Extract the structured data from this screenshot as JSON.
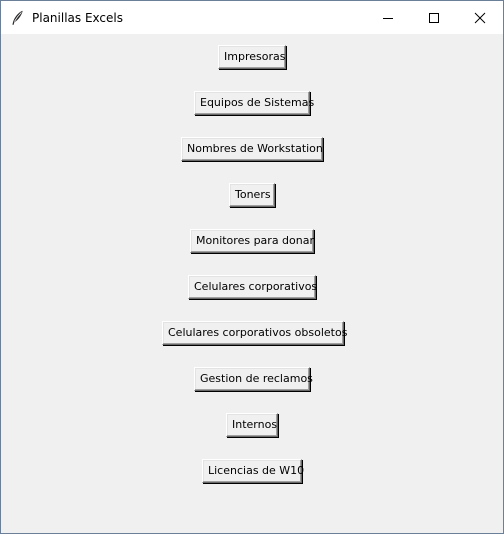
{
  "window": {
    "title": "Planillas Excels",
    "app_icon": "feather-icon",
    "controls": {
      "minimize_icon": "minimize-icon",
      "maximize_icon": "maximize-icon",
      "close_icon": "close-icon"
    }
  },
  "buttons": [
    {
      "label": "Impresoras"
    },
    {
      "label": "Equipos de Sistemas"
    },
    {
      "label": "Nombres de Workstation"
    },
    {
      "label": "Toners"
    },
    {
      "label": "Monitores para donar"
    },
    {
      "label": "Celulares corporativos"
    },
    {
      "label": "Celulares corporativos obsoletos"
    },
    {
      "label": "Gestion de reclamos"
    },
    {
      "label": "Internos"
    },
    {
      "label": "Licencias de W10"
    }
  ],
  "colors": {
    "titlebar_bg": "#ffffff",
    "client_bg": "#f0f0f0",
    "button_face": "#f0f0f0",
    "text": "#000000"
  }
}
